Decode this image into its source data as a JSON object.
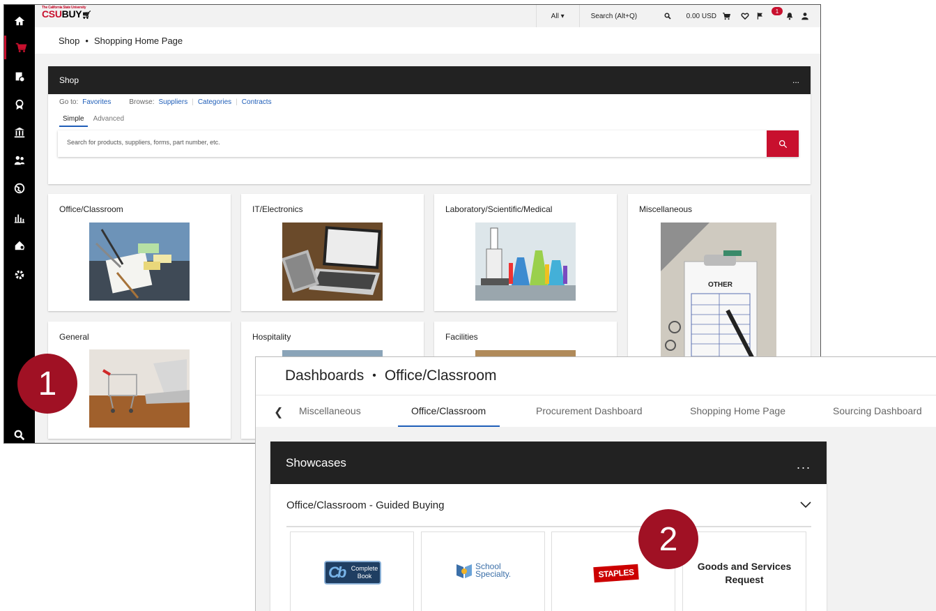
{
  "screen1": {
    "brand": {
      "name_red": "CSU",
      "name_black": "BUY",
      "tagline": "The California State University"
    },
    "topbar": {
      "scope": "All ▾",
      "search_label": "Search (Alt+Q)",
      "cart_total": "0.00 USD",
      "notification_count": "1"
    },
    "breadcrumb": {
      "part1": "Shop",
      "part2": "Shopping Home Page"
    },
    "shop_panel": {
      "title": "Shop",
      "menu": "...",
      "goto_label": "Go to:",
      "goto_favorites": "Favorites",
      "browse_label": "Browse:",
      "browse_suppliers": "Suppliers",
      "browse_categories": "Categories",
      "browse_contracts": "Contracts",
      "tab_simple": "Simple",
      "tab_advanced": "Advanced",
      "search_placeholder": "Search for products, suppliers, forms, part number, etc."
    },
    "categories": [
      "Office/Classroom",
      "IT/Electronics",
      "Laboratory/Scientific/Medical",
      "Miscellaneous",
      "General",
      "Hospitality",
      "Facilities"
    ],
    "misc_card_text": "OTHER",
    "sidebar_icons": [
      "home-icon",
      "cart-icon",
      "orders-icon",
      "award-icon",
      "bank-icon",
      "people-icon",
      "globe-icon",
      "chart-icon",
      "settings-gear-icon",
      "gear-icon",
      "search-icon"
    ],
    "accent": "#c8102e"
  },
  "screen2": {
    "breadcrumb": {
      "part1": "Dashboards",
      "part2": "Office/Classroom"
    },
    "tabs": [
      "Miscellaneous",
      "Office/Classroom",
      "Procurement Dashboard",
      "Shopping Home Page",
      "Sourcing Dashboard"
    ],
    "active_tab": "Office/Classroom",
    "showcases_title": "Showcases",
    "showcases_menu": "...",
    "guided_title": "Office/Classroom - Guided Buying",
    "tiles": {
      "complete_book_a": "Complete",
      "complete_book_b": "Book",
      "school_a": "School",
      "school_b": "Specialty.",
      "staples": "STAPLES",
      "gsr_line1": "Goods and Services",
      "gsr_line2": "Request"
    },
    "accent": "#1f5eb8"
  },
  "markers": {
    "one": "1",
    "two": "2"
  }
}
